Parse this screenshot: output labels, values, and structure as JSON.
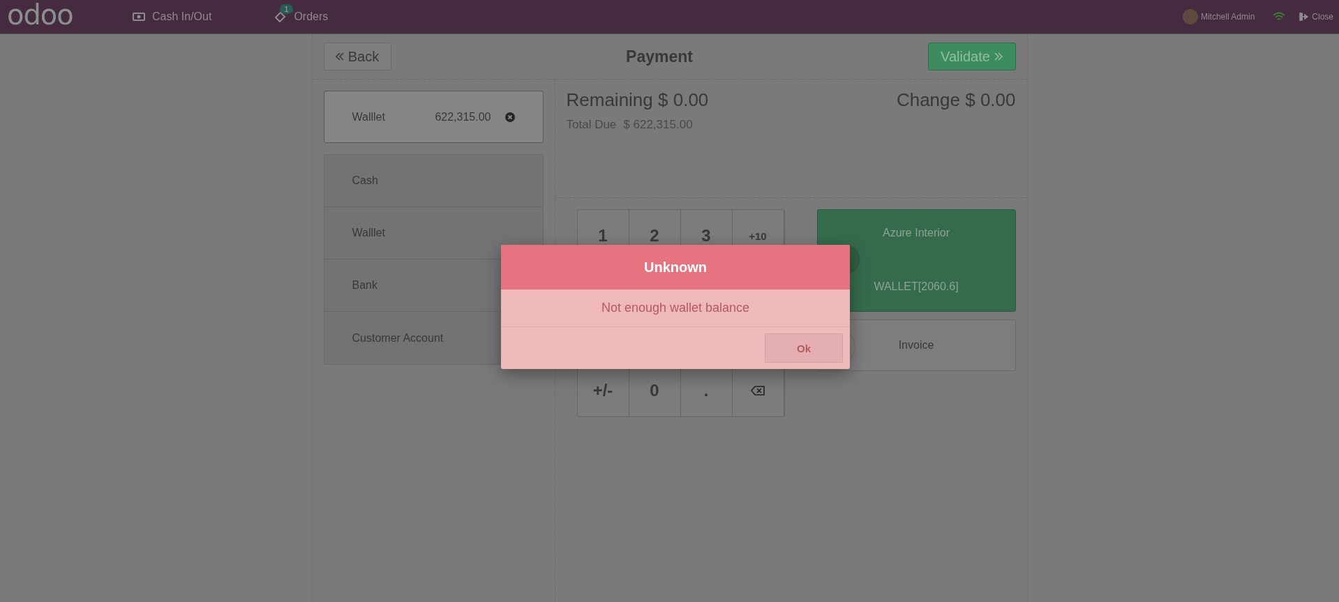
{
  "topbar": {
    "logo": "odoo",
    "nav": [
      {
        "label": "Cash In/Out",
        "kind": "cash"
      },
      {
        "label": "Orders",
        "kind": "orders",
        "badge": "1"
      }
    ],
    "user": "Mitchell Admin",
    "close": "Close"
  },
  "header": {
    "back": "Back",
    "title": "Payment",
    "validate": "Validate"
  },
  "payment_lines": [
    {
      "method": "Walllet",
      "amount": "622,315.00",
      "selected": true
    }
  ],
  "payment_methods": [
    "Cash",
    "Walllet",
    "Bank",
    "Customer Account"
  ],
  "summary": {
    "remaining_label": "Remaining",
    "remaining": "$ 0.00",
    "change_label": "Change",
    "change": "$ 0.00",
    "total_due_label": "Total Due",
    "total_due": "$ 622,315.00"
  },
  "numpad": {
    "top_row": [
      {
        "kind": "digit",
        "label": "1"
      },
      {
        "kind": "digit",
        "label": "2"
      },
      {
        "kind": "digit",
        "label": "3"
      },
      {
        "kind": "small",
        "label": "+10"
      }
    ],
    "bottom_row": [
      {
        "kind": "digit",
        "label": "+/-"
      },
      {
        "kind": "digit",
        "label": "0"
      },
      {
        "kind": "digit",
        "label": "."
      },
      {
        "kind": "backspace"
      }
    ]
  },
  "customer": {
    "name": "Azure Interior",
    "wallet": "WALLET[2060.6]"
  },
  "invoice": {
    "label": "Invoice"
  },
  "dialog": {
    "title": "Unknown",
    "message": "Not enough wallet balance",
    "button": "Ok"
  }
}
